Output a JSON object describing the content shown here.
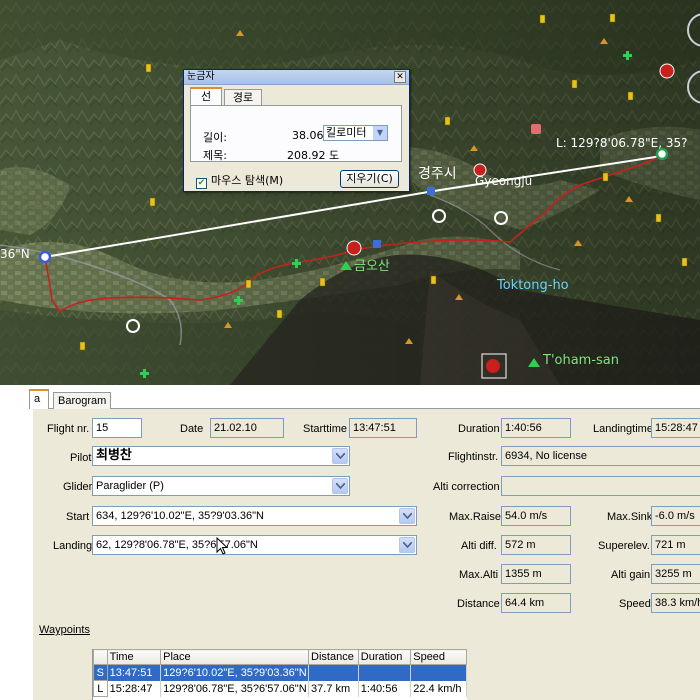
{
  "map": {
    "labels": {
      "coord_left": "36\"N",
      "coord_right": "L: 129?8'06.78\"E, 35?",
      "city_korean": "경주시",
      "city": "Gyeongju",
      "mountain_korean": "금오산",
      "lake": "Toktong-ho",
      "peak": "T'oham-san"
    }
  },
  "ruler": {
    "title": "눈금자",
    "tabs": [
      "선",
      "경로"
    ],
    "length_label": "길이:",
    "length_value": "38.06",
    "unit": "킬로미터",
    "heading_label": "제목:",
    "heading_value": "208.92 도",
    "mouse_nav_label": "마우스 탐색(M)",
    "clear_button": "지우기(C)"
  },
  "panel": {
    "tabs": [
      "a",
      "Barogram"
    ],
    "flight_nr_label": "Flight nr.",
    "flight_nr": "15",
    "date_label": "Date",
    "date": "21.02.10",
    "starttime_label": "Starttime",
    "starttime": "13:47:51",
    "duration_label": "Duration",
    "duration": "1:40:56",
    "landingtime_label": "Landingtime",
    "landingtime": "15:28:47",
    "pilot_label": "Pilot",
    "pilot": "최병찬",
    "flightinstr_label": "Flightinstr.",
    "flightinstr": "6934, No license",
    "glider_label": "Glider",
    "glider": "Paraglider (P)",
    "alti_correction_label": "Alti correction",
    "alti_correction": "",
    "start_label": "Start",
    "start": "634, 129?6'10.02\"E, 35?9'03.36\"N",
    "max_raise_label": "Max.Raise",
    "max_raise": "54.0 m/s",
    "max_sink_label": "Max.Sink",
    "max_sink": "-6.0 m/s",
    "landing_label": "Landing",
    "landing": "62, 129?8'06.78\"E, 35?6'57.06\"N",
    "alti_diff_label": "Alti diff.",
    "alti_diff": "572 m",
    "superelev_label": "Superelev.",
    "superelev": "721 m",
    "max_alti_label": "Max.Alti",
    "max_alti": "1355 m",
    "alti_gain_label": "Alti gain",
    "alti_gain": "3255 m",
    "distance_label": "Distance",
    "distance": "64.4 km",
    "speed_label": "Speed",
    "speed": "38.3 km/h",
    "waypoints_label": "Waypoints",
    "waypoints": {
      "columns": [
        "Time",
        "Place",
        "Distance",
        "Duration",
        "Speed"
      ],
      "rows": [
        {
          "key": "S",
          "time": "13:47:51",
          "place": "129?6'10.02\"E, 35?9'03.36\"N",
          "distance": "",
          "duration": "",
          "speed": ""
        },
        {
          "key": "L",
          "time": "15:28:47",
          "place": "129?8'06.78\"E, 35?6'57.06\"N",
          "distance": "37.7 km",
          "duration": "1:40:56",
          "speed": "22.4 km/h"
        }
      ]
    }
  },
  "colors": {
    "track_red": "#c8201c",
    "ruler_line": "#ffffff",
    "selection": "#316ac5",
    "form_bg": "#ece9d8"
  }
}
